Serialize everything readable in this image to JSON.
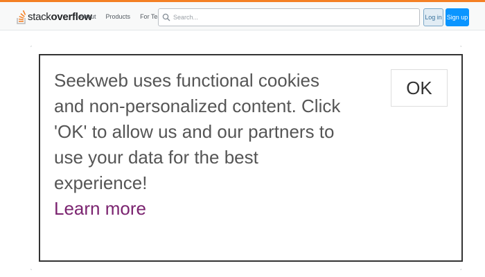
{
  "header": {
    "logo": {
      "prefix": "stack",
      "suffix": "overflow",
      "icon": "stack-overflow-logo-icon",
      "accent_color": "#f48024"
    },
    "nav": [
      {
        "label": "About"
      },
      {
        "label": "Products"
      },
      {
        "label": "For Teams"
      }
    ],
    "search": {
      "placeholder": "Search...",
      "value": "",
      "icon": "search-icon"
    },
    "login_label": "Log in",
    "signup_label": "Sign up"
  },
  "cookie_modal": {
    "message": "Seekweb uses functional cookies and non-personalized content. Click 'OK' to allow us and our partners to use your data for the best experience!",
    "learn_more_label": "Learn more",
    "ok_label": "OK",
    "learn_more_color": "#7b2470"
  }
}
